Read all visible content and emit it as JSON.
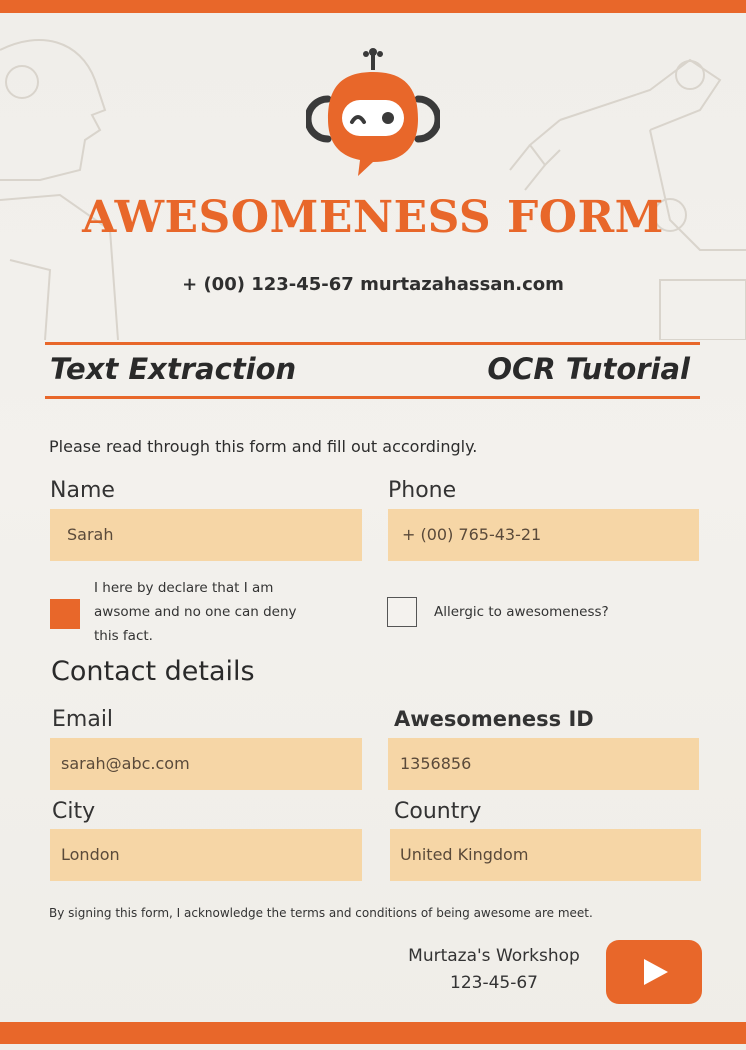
{
  "header": {
    "title": "AWESOMENESS FORM",
    "contact": "+ (00) 123-45-67 murtazahassan.com"
  },
  "banner": {
    "left": "Text Extraction",
    "right": "OCR Tutorial"
  },
  "instructions": "Please read through this form and fill out accordingly.",
  "fields": {
    "name": {
      "label": "Name",
      "value": "Sarah"
    },
    "phone": {
      "label": "Phone",
      "value": "+ (00) 765-43-21"
    },
    "email": {
      "label": "Email",
      "value": "sarah@abc.com"
    },
    "awesomeness_id": {
      "label": "Awesomeness ID",
      "value": "1356856"
    },
    "city": {
      "label": "City",
      "value": "London"
    },
    "country": {
      "label": "Country",
      "value": "United Kingdom"
    }
  },
  "checkboxes": {
    "declare": {
      "checked": true,
      "lines": [
        "I here by declare that I am",
        "awsome and no one can deny",
        "this fact."
      ]
    },
    "allergic": {
      "checked": false,
      "label": "Allergic to awesomeness?"
    }
  },
  "section_heading": "Contact details",
  "terms": "By signing this form, I acknowledge the terms and conditions of being awesome are meet.",
  "footer": {
    "name": "Murtaza's Workshop",
    "phone": "123-45-67",
    "icon": "youtube-play-icon"
  },
  "colors": {
    "accent": "#e8672a",
    "field_bg": "#f6d6a6"
  }
}
